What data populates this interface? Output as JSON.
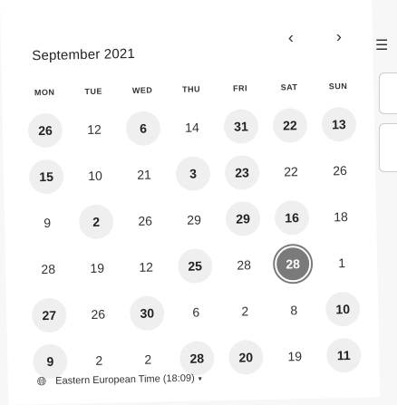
{
  "calendar": {
    "month_title": "September 2021",
    "prev_icon": "‹",
    "next_icon": "›",
    "weekdays": [
      "MON",
      "TUE",
      "WED",
      "THU",
      "FRI",
      "SAT",
      "SUN"
    ],
    "weeks": [
      [
        {
          "d": "26",
          "s": "avail"
        },
        {
          "d": "12",
          "s": ""
        },
        {
          "d": "6",
          "s": "avail"
        },
        {
          "d": "14",
          "s": ""
        },
        {
          "d": "31",
          "s": "avail"
        },
        {
          "d": "22",
          "s": "avail"
        },
        {
          "d": "13",
          "s": "avail"
        }
      ],
      [
        {
          "d": "15",
          "s": "avail"
        },
        {
          "d": "10",
          "s": ""
        },
        {
          "d": "21",
          "s": ""
        },
        {
          "d": "3",
          "s": "avail"
        },
        {
          "d": "23",
          "s": "avail"
        },
        {
          "d": "22",
          "s": ""
        },
        {
          "d": "26",
          "s": ""
        }
      ],
      [
        {
          "d": "9",
          "s": ""
        },
        {
          "d": "2",
          "s": "avail"
        },
        {
          "d": "26",
          "s": ""
        },
        {
          "d": "29",
          "s": ""
        },
        {
          "d": "29",
          "s": "avail"
        },
        {
          "d": "16",
          "s": "avail"
        },
        {
          "d": "18",
          "s": ""
        }
      ],
      [
        {
          "d": "28",
          "s": ""
        },
        {
          "d": "19",
          "s": ""
        },
        {
          "d": "12",
          "s": ""
        },
        {
          "d": "25",
          "s": "avail"
        },
        {
          "d": "28",
          "s": ""
        },
        {
          "d": "28",
          "s": "sel"
        },
        {
          "d": "1",
          "s": ""
        }
      ],
      [
        {
          "d": "27",
          "s": "avail"
        },
        {
          "d": "26",
          "s": ""
        },
        {
          "d": "30",
          "s": "avail"
        },
        {
          "d": "6",
          "s": ""
        },
        {
          "d": "2",
          "s": ""
        },
        {
          "d": "8",
          "s": ""
        },
        {
          "d": "10",
          "s": "avail"
        }
      ],
      [
        {
          "d": "9",
          "s": "avail"
        },
        {
          "d": "2",
          "s": ""
        },
        {
          "d": "2",
          "s": ""
        },
        {
          "d": "28",
          "s": "avail"
        },
        {
          "d": "20",
          "s": "avail"
        },
        {
          "d": "19",
          "s": ""
        },
        {
          "d": "11",
          "s": "avail"
        }
      ]
    ]
  },
  "timezone": {
    "globe_icon": "globe-icon",
    "label": "Eastern European Time (18:09)",
    "caret": "▾"
  },
  "colors": {
    "available_bg": "#efefef",
    "selected_bg": "#7a7a7a"
  }
}
